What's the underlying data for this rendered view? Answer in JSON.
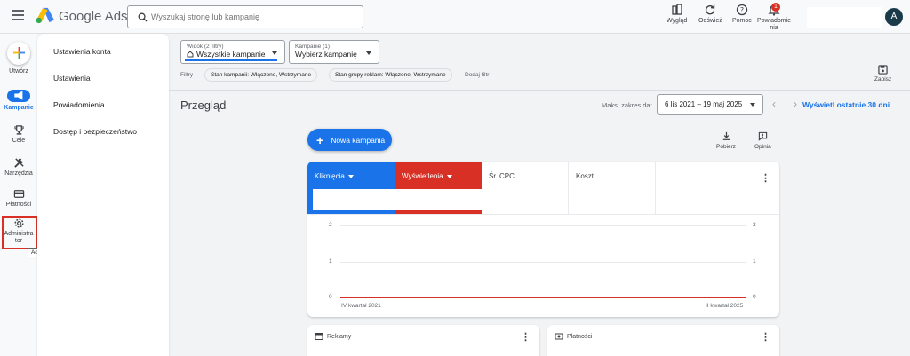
{
  "header": {
    "app_name": "Google Ads",
    "search_placeholder": "Wyszukaj stronę lub kampanię",
    "tools": [
      {
        "label": "Wygląd",
        "icon": "appearance-icon"
      },
      {
        "label": "Odśwież",
        "icon": "refresh-icon"
      },
      {
        "label": "Pomoc",
        "icon": "help-icon"
      },
      {
        "label": "Powiadomie nia",
        "icon": "bell-icon"
      }
    ],
    "notification_count": "1",
    "avatar_letter": "A"
  },
  "rail": {
    "items": [
      {
        "label": "Utwórz",
        "icon": "create-plus-icon"
      },
      {
        "label": "Kampanie",
        "icon": "campaigns-icon"
      },
      {
        "label": "Cele",
        "icon": "trophy-icon"
      },
      {
        "label": "Narzędzia",
        "icon": "tools-icon"
      },
      {
        "label": "Płatności",
        "icon": "credit-card-icon"
      },
      {
        "label": "Administra tor",
        "icon": "gear-icon"
      }
    ],
    "tooltip": "Administrator"
  },
  "settings_panel": {
    "items": [
      "Ustawienia konta",
      "Ustawienia",
      "Powiadomienia",
      "Dostęp i bezpieczeństwo"
    ]
  },
  "filters": {
    "view_small": "Widok (2 filtry)",
    "view_big": "Wszystkie kampanie",
    "campaign_small": "Kampanie (1)",
    "campaign_big": "Wybierz kampanię",
    "label": "Filtry",
    "chips": [
      "Stan kampanii: Włączone, Wstrzymane",
      "Stan grupy reklam: Włączone, Wstrzymane"
    ],
    "add_filter": "Dodaj filtr",
    "save": "Zapisz"
  },
  "overview": {
    "title": "Przegląd",
    "range_label": "Maks. zakres dat",
    "date_range": "6 lis 2021 – 19 maj 2025",
    "last_30": "Wyświetl ostatnie 30 dni",
    "new_campaign": "Nowa kampania",
    "download": "Pobierz",
    "feedback": "Opinia"
  },
  "chart": {
    "metrics": [
      {
        "label": "Kliknięcia",
        "color": "#1a73e8"
      },
      {
        "label": "Wyświetlenia",
        "color": "#d93025"
      },
      {
        "label": "Śr. CPC",
        "color": "#ffffff"
      },
      {
        "label": "Koszt",
        "color": "#ffffff"
      }
    ],
    "y_ticks": [
      "2",
      "1",
      "0"
    ],
    "x_start": "IV kwartał 2021",
    "x_end": "II kwartał 2025"
  },
  "bottom_cards": [
    "Reklamy",
    "Płatności"
  ]
}
